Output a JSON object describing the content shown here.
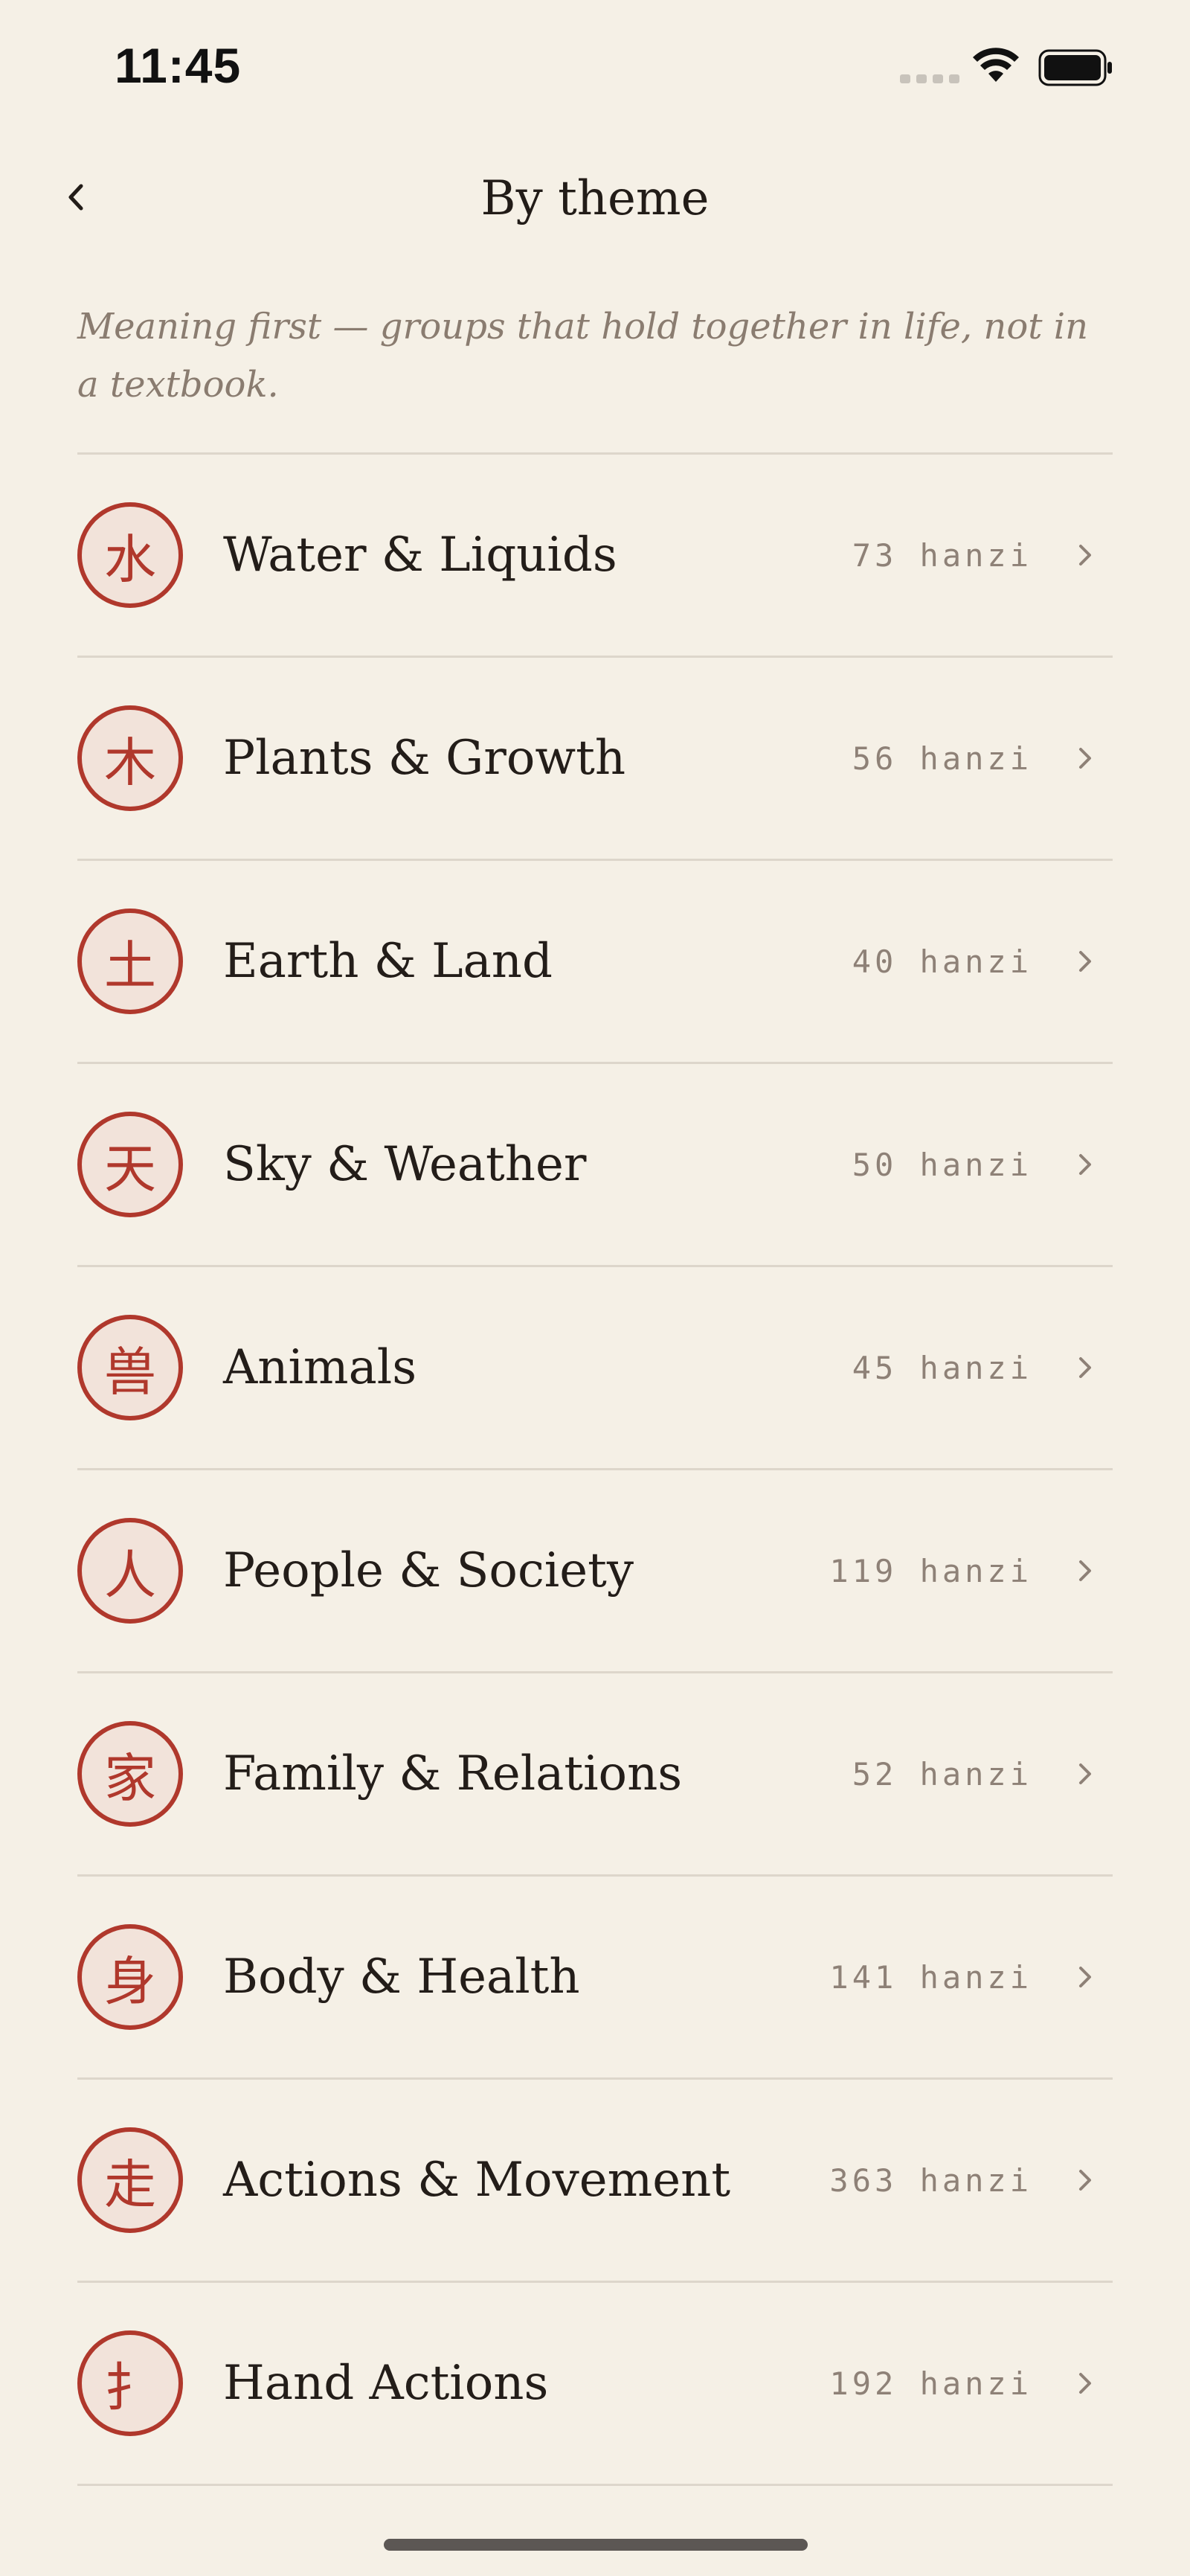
{
  "status_bar": {
    "time": "11:45"
  },
  "header": {
    "title": "By theme"
  },
  "subtitle": "Meaning first — groups that hold together in life, not in a textbook.",
  "themes": [
    {
      "glyph": "水",
      "name": "Water & Liquids",
      "count": "73 hanzi"
    },
    {
      "glyph": "木",
      "name": "Plants & Growth",
      "count": "56 hanzi"
    },
    {
      "glyph": "土",
      "name": "Earth & Land",
      "count": "40 hanzi"
    },
    {
      "glyph": "天",
      "name": "Sky & Weather",
      "count": "50 hanzi"
    },
    {
      "glyph": "兽",
      "name": "Animals",
      "count": "45 hanzi"
    },
    {
      "glyph": "人",
      "name": "People & Society",
      "count": "119 hanzi"
    },
    {
      "glyph": "家",
      "name": "Family & Relations",
      "count": "52 hanzi"
    },
    {
      "glyph": "身",
      "name": "Body & Health",
      "count": "141 hanzi"
    },
    {
      "glyph": "走",
      "name": "Actions & Movement",
      "count": "363 hanzi"
    },
    {
      "glyph": "扌",
      "name": "Hand Actions",
      "count": "192 hanzi"
    }
  ],
  "colors": {
    "background": "#f5f0e6",
    "accent": "#b0382c",
    "badge_fill": "#f2e3da",
    "muted_text": "#8a7c70",
    "divider": "#ddd6cb"
  },
  "icons": {
    "back": "chevron-left-icon",
    "row_chevron": "chevron-right-icon",
    "wifi": "wifi-icon",
    "battery": "battery-icon",
    "signal": "cellular-signal-icon"
  }
}
